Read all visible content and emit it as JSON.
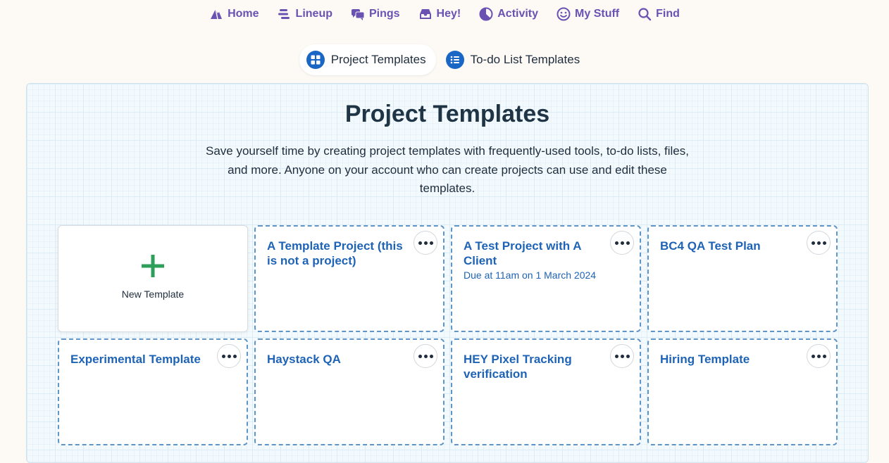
{
  "nav": {
    "items": [
      {
        "label": "Home",
        "icon": "home-mountain-icon"
      },
      {
        "label": "Lineup",
        "icon": "lineup-icon"
      },
      {
        "label": "Pings",
        "icon": "pings-chat-icon"
      },
      {
        "label": "Hey!",
        "icon": "hey-inbox-icon"
      },
      {
        "label": "Activity",
        "icon": "activity-icon"
      },
      {
        "label": "My Stuff",
        "icon": "smiley-face-icon"
      },
      {
        "label": "Find",
        "icon": "search-icon"
      }
    ],
    "color": "#6a52b3"
  },
  "switcher": {
    "tabs": [
      {
        "label": "Project Templates",
        "icon": "grid-icon",
        "active": true
      },
      {
        "label": "To-do List Templates",
        "icon": "list-icon",
        "active": false
      }
    ]
  },
  "panel": {
    "title": "Project Templates",
    "description": "Save yourself time by creating project templates with frequently-used tools, to-do lists, files, and more. Anyone on your account who can create projects can use and edit these templates."
  },
  "new_template": {
    "label": "New Template",
    "icon": "plus-icon",
    "color": "#2e9e5b"
  },
  "templates": [
    {
      "title": "A Template Project (this is not a project)",
      "subtitle": ""
    },
    {
      "title": "A Test Project with A Client",
      "subtitle": "Due at 11am on 1 March 2024"
    },
    {
      "title": "BC4 QA Test Plan",
      "subtitle": ""
    },
    {
      "title": "Experimental Template",
      "subtitle": ""
    },
    {
      "title": "Haystack QA",
      "subtitle": ""
    },
    {
      "title": "HEY Pixel Tracking verification",
      "subtitle": ""
    },
    {
      "title": "Hiring Template",
      "subtitle": ""
    }
  ],
  "colors": {
    "accent": "#1e63b6",
    "tab_icon": "#1a66c5",
    "background": "#fdf9f5"
  }
}
